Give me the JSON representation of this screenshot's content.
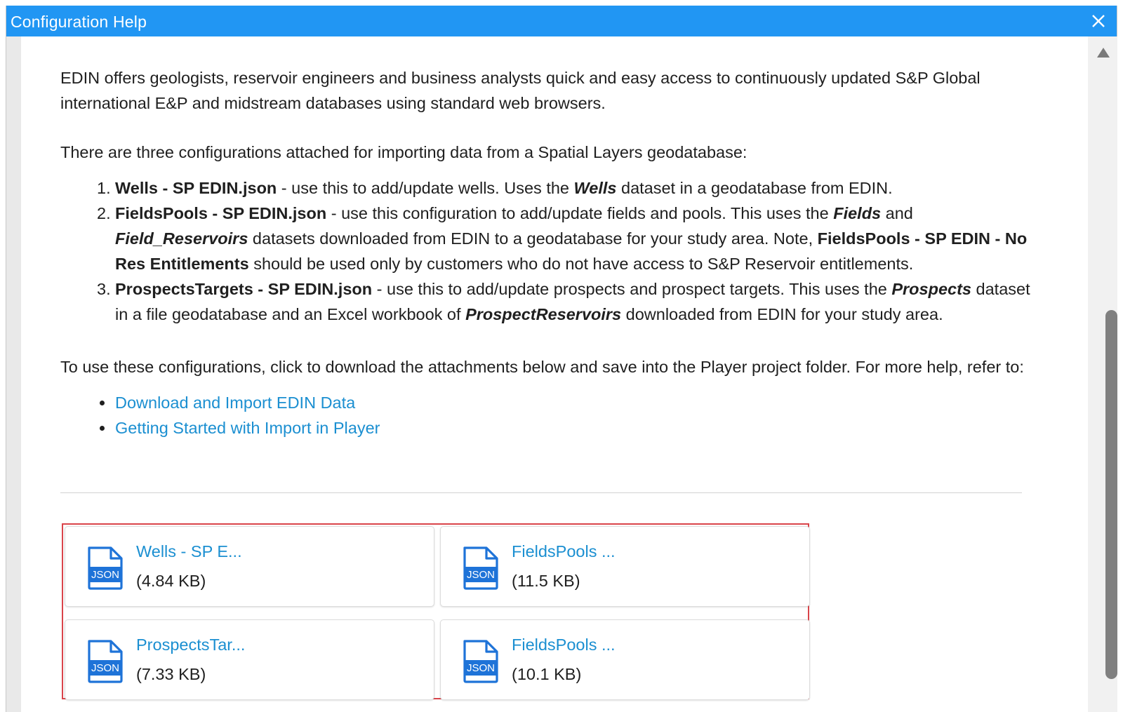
{
  "window": {
    "title": "Configuration Help"
  },
  "intro": {
    "paragraph": "EDIN offers geologists, reservoir engineers and business analysts quick and easy access to continuously updated S&P Global international E&P and midstream databases using standard web browsers.",
    "configs_lead": "There are three configurations attached for importing data from a Spatial Layers geodatabase:"
  },
  "configs": [
    {
      "num": "1.",
      "name": "Wells - SP EDIN.json",
      "t1": " - use this to add/update wells. Uses the ",
      "e1": "Wells",
      "t2": " dataset in a geodatabase from EDIN."
    },
    {
      "num": "2.",
      "name": "FieldsPools - SP EDIN.json",
      "t1": " - use this configuration to add/update fields and pools. This uses the ",
      "e1": "Fields",
      "t2": " and ",
      "e2": "Field_Reservoirs",
      "t3": " datasets downloaded from EDIN to a geodatabase for your study area. Note, ",
      "b2": "FieldsPools - SP EDIN - No Res Entitlements",
      "t4": " should be used only by customers who do not have access to S&P Reservoir entitlements."
    },
    {
      "num": "3.",
      "name": "ProspectsTargets - SP EDIN.json",
      "t1": " - use this to add/update prospects and prospect targets. This uses the ",
      "e1": "Prospects",
      "t2": " dataset in a file geodatabase and an Excel workbook of ",
      "e2": "ProspectReservoirs",
      "t3": " downloaded from EDIN for your study area."
    }
  ],
  "help": {
    "lead": "To use these configurations, click to download the attachments below and save into the Player project folder. For more help, refer to:",
    "links": [
      "Download and Import EDIN Data",
      "Getting Started with Import in Player"
    ]
  },
  "attachments": [
    {
      "name": "Wells - SP E...",
      "size": "(4.84 KB)",
      "badge": "JSON",
      "icon": "json-file-icon"
    },
    {
      "name": "FieldsPools ...",
      "size": "(11.5 KB)",
      "badge": "JSON",
      "icon": "json-file-icon"
    },
    {
      "name": "ProspectsTar...",
      "size": "(7.33 KB)",
      "badge": "JSON",
      "icon": "json-file-icon"
    },
    {
      "name": "FieldsPools ...",
      "size": "(10.1 KB)",
      "badge": "JSON",
      "icon": "json-file-icon"
    }
  ],
  "colors": {
    "titlebar": "#2196f3",
    "link": "#1b8fd1",
    "highlight_border": "#d9444a",
    "json_icon": "#1e73d8"
  }
}
